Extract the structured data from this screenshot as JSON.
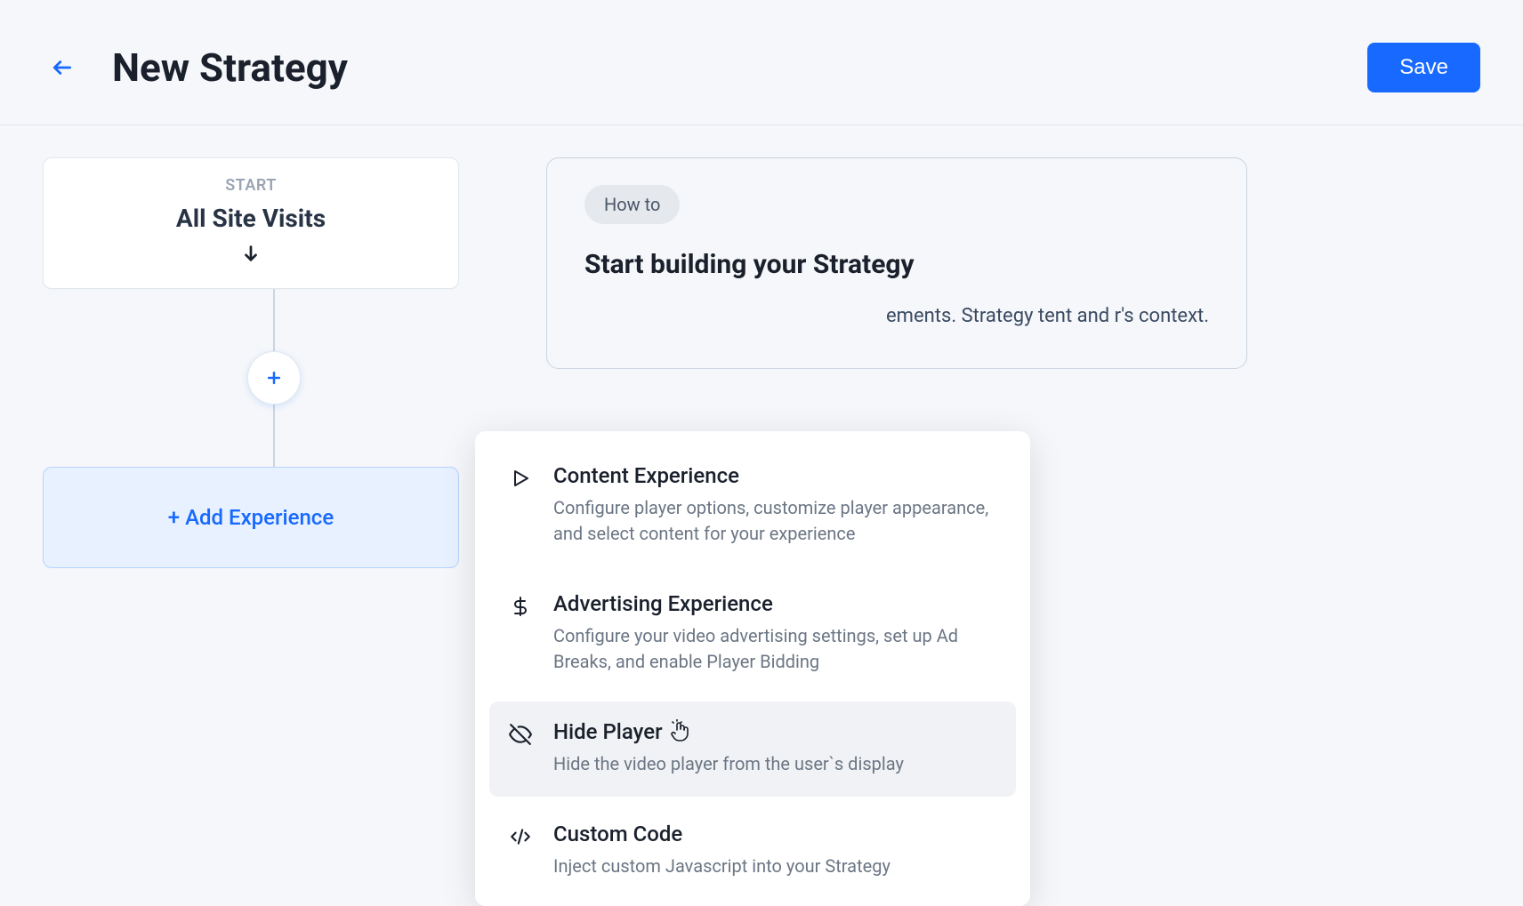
{
  "header": {
    "title": "New Strategy",
    "save_label": "Save"
  },
  "start_node": {
    "label": "START",
    "title": "All Site Visits"
  },
  "add_experience": {
    "label": "+ Add Experience"
  },
  "howto": {
    "badge": "How to",
    "title": "Start building your Strategy",
    "body_visible": "ements. Strategy tent and r's context."
  },
  "dropdown": {
    "items": [
      {
        "title": "Content Experience",
        "desc": "Configure player options, customize player appearance, and select content for your experience",
        "icon": "play-icon"
      },
      {
        "title": "Advertising Experience",
        "desc": "Configure your video advertising settings, set up Ad Breaks, and enable Player Bidding",
        "icon": "dollar-icon"
      },
      {
        "title": "Hide Player",
        "desc": "Hide the video player from the user`s display",
        "icon": "eye-off-icon",
        "highlighted": true
      },
      {
        "title": "Custom Code",
        "desc": "Inject custom Javascript into your Strategy",
        "icon": "code-icon"
      }
    ]
  }
}
